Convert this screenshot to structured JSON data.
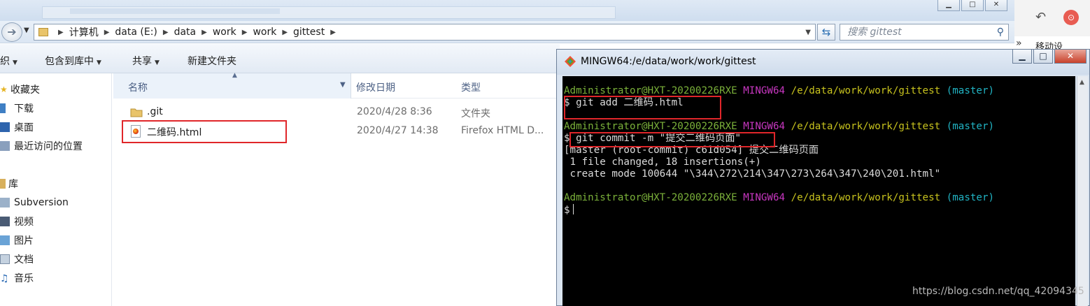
{
  "explorer": {
    "breadcrumb": [
      "计算机",
      "data (E:)",
      "data",
      "work",
      "work",
      "gittest"
    ],
    "search_placeholder": "搜索 gittest",
    "toolbar": {
      "organize": "织",
      "include_in_library": "包含到库中",
      "share": "共享",
      "new_folder": "新建文件夹"
    },
    "nav": {
      "favorites": "收藏夹",
      "downloads": "下载",
      "desktop": "桌面",
      "recent": "最近访问的位置",
      "libraries": "库",
      "subversion": "Subversion",
      "videos": "视频",
      "pictures": "图片",
      "documents": "文档",
      "music": "音乐"
    },
    "columns": {
      "name": "名称",
      "modified": "修改日期",
      "type": "类型"
    },
    "files": [
      {
        "name": ".git",
        "modified": "2020/4/28 8:36",
        "type": "文件夹"
      },
      {
        "name": "二维码.html",
        "modified": "2020/4/27 14:38",
        "type": "Firefox HTML D..."
      }
    ]
  },
  "right_panel": {
    "label": "移动设"
  },
  "terminal": {
    "title": "MINGW64:/e/data/work/work/gittest",
    "prompt": {
      "user": "Administrator@HXT-20200226RXE",
      "env": "MINGW64",
      "path": "/e/data/work/work/gittest",
      "branch": "(master)",
      "symbol": "$"
    },
    "commands": {
      "add": "git add 二维码.html",
      "commit": "git commit -m \"提交二维码页面\""
    },
    "output": {
      "line1": "[master (root-commit) c61d054] 提交二维码页面",
      "line2": " 1 file changed, 18 insertions(+)",
      "line3": " create mode 100644 \"\\344\\272\\214\\347\\273\\264\\347\\240\\201.html\""
    }
  },
  "watermark": "https://blog.csdn.net/qq_42094345",
  "colors": {
    "highlight_red": "#e0262a",
    "term_green": "#7bb13a",
    "term_magenta": "#c837c1",
    "term_yellow": "#c7c21e",
    "term_cyan": "#21b4c4"
  }
}
